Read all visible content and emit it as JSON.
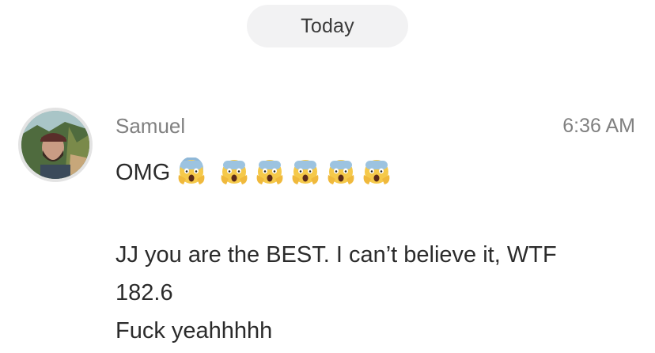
{
  "date_divider": {
    "label": "Today"
  },
  "message": {
    "sender": "Samuel",
    "time": "6:36 AM",
    "avatar_icon": "user-photo-avatar",
    "first_line_text": "OMG",
    "emoji_icon": "face-screaming-in-fear-emoji",
    "emoji_count": 6,
    "lines": [
      "JJ you are the BEST. I can’t believe it, WTF",
      "182.6",
      "Fuck yeahhhhh"
    ]
  }
}
